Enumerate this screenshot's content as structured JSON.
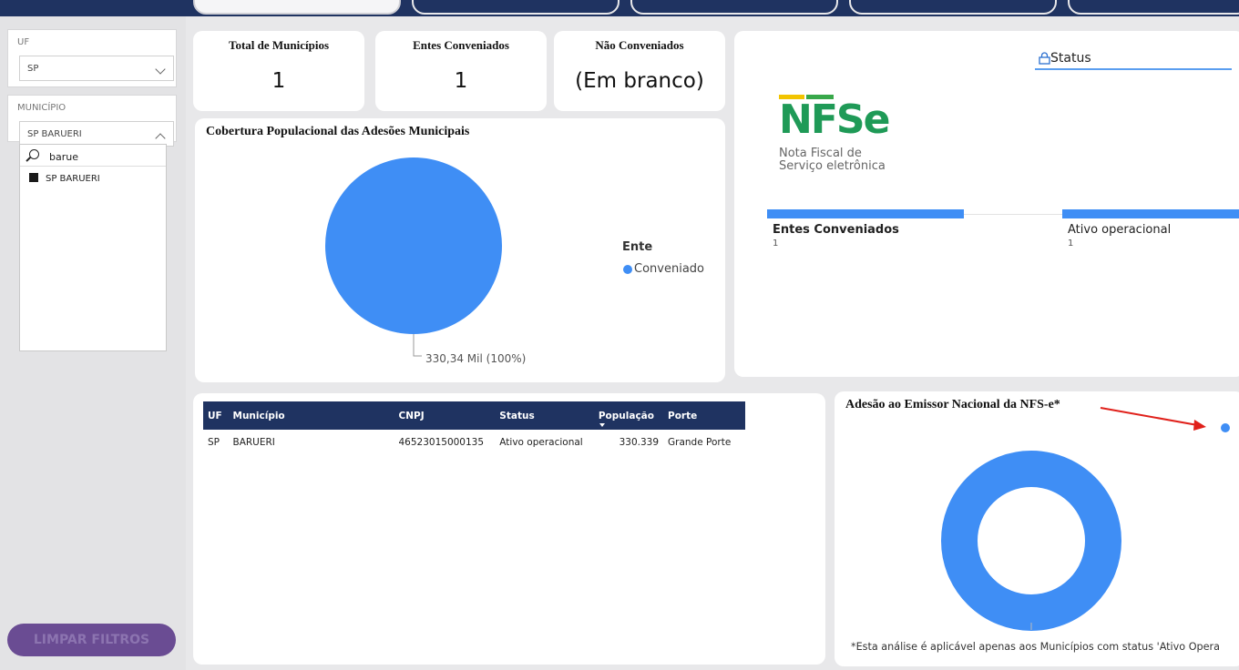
{
  "sidebar": {
    "uf_slicer": {
      "label": "UF",
      "value": "SP"
    },
    "municipio_slicer": {
      "label": "MUNICÍPIO",
      "value": "SP BARUERI",
      "search_text": "barue",
      "options": [
        "SP BARUERI"
      ]
    },
    "clear_button": "LIMPAR FILTROS"
  },
  "kpis": {
    "total": {
      "title": "Total de Municípios",
      "value": "1"
    },
    "conveniados": {
      "title": "Entes Conveniados",
      "value": "1"
    },
    "nao_conveniados": {
      "title": "Não Conveniados",
      "value": "(Em branco)"
    }
  },
  "pie_card": {
    "title": "Cobertura Populacional das Adesões Municipais",
    "data_label": "330,34 Mil (100%)",
    "legend_title": "Ente",
    "legend_item": "Conveniado"
  },
  "logo_card": {
    "logo_letters": "NFSe",
    "logo_sub1": "Nota Fiscal de",
    "logo_sub2": "Serviço eletrônica",
    "status_label": "Status",
    "bar1_label": "Entes Conveniados",
    "bar1_value": "1",
    "bar2_label": "Ativo operacional",
    "bar2_value": "1"
  },
  "table": {
    "headers": [
      "UF",
      "Município",
      "CNPJ",
      "Status",
      "População",
      "Porte"
    ],
    "rows": [
      [
        "SP",
        "BARUERI",
        "46523015000135",
        "Ativo operacional",
        "330.339",
        "Grande Porte"
      ]
    ]
  },
  "donut_card": {
    "title": "Adesão ao Emissor Nacional da NFS-e*",
    "footnote": "*Esta análise é aplicável apenas aos Municípios com status 'Ativo Opera"
  },
  "colors": {
    "navy": "#1f3361",
    "accent_blue": "#3f8ef5",
    "purple_button": "#6a4c93",
    "arrow_red": "#e0201a"
  },
  "chart_data": [
    {
      "type": "pie",
      "title": "Cobertura Populacional das Adesões Municipais",
      "legend_title": "Ente",
      "categories": [
        "Conveniado"
      ],
      "values": [
        330.34
      ],
      "data_labels": [
        "330,34 Mil (100%)"
      ],
      "legend_placement": "right"
    },
    {
      "type": "pie",
      "title": "Adesão ao Emissor Nacional da NFS-e*",
      "categories": [
        ""
      ],
      "values": [
        100
      ]
    }
  ]
}
